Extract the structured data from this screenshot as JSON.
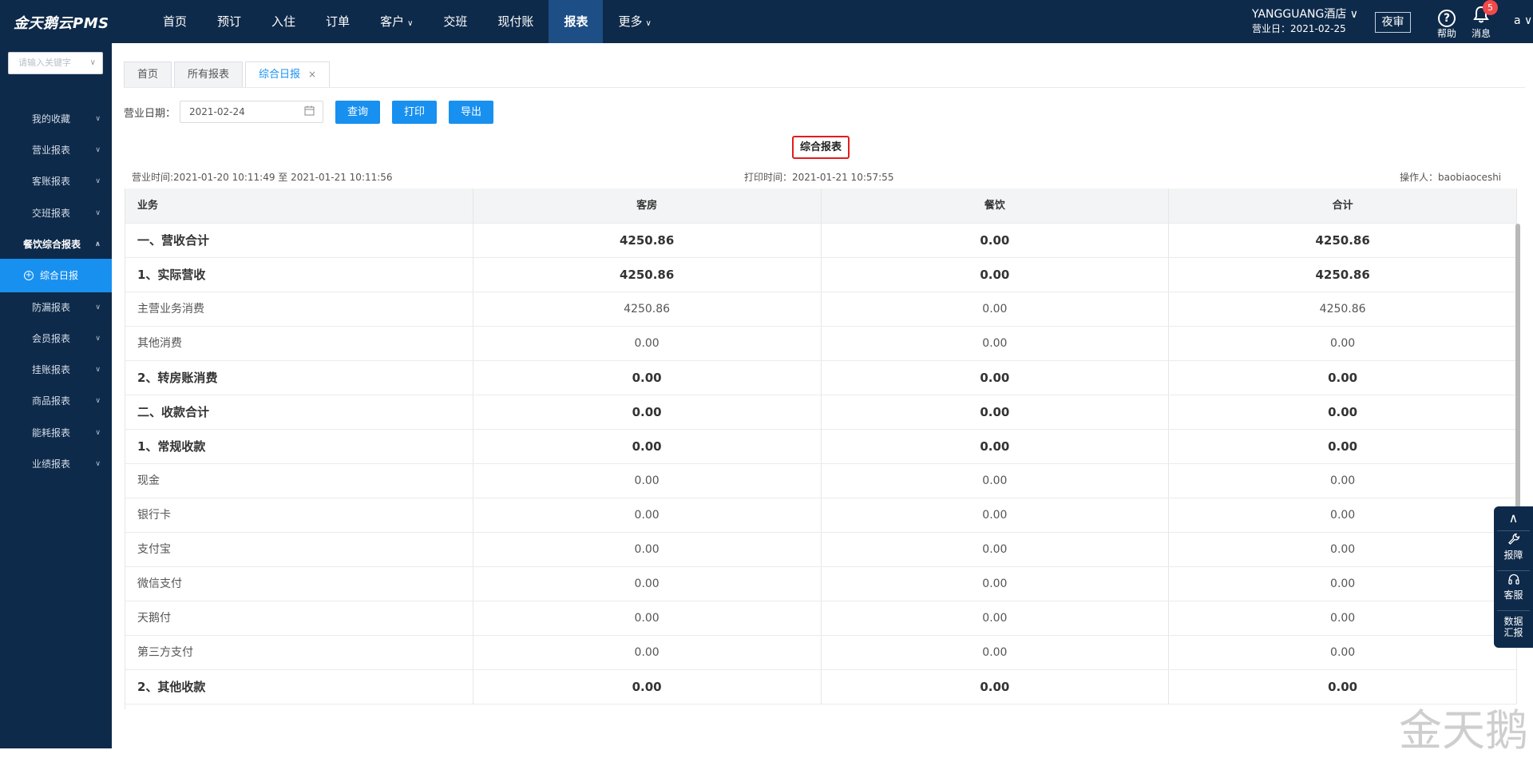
{
  "app": {
    "logo": "金天鹅云PMS"
  },
  "nav": {
    "items": [
      {
        "label": "首页",
        "caret": ""
      },
      {
        "label": "预订",
        "caret": ""
      },
      {
        "label": "入住",
        "caret": ""
      },
      {
        "label": "订单",
        "caret": ""
      },
      {
        "label": "客户",
        "caret": "∨"
      },
      {
        "label": "交班",
        "caret": ""
      },
      {
        "label": "现付账",
        "caret": ""
      },
      {
        "label": "报表",
        "caret": ""
      },
      {
        "label": "更多",
        "caret": "∨"
      }
    ],
    "active_index": 7
  },
  "header": {
    "hotel_name": "YANGGUANG酒店 ∨",
    "business_day": "营业日：2021-02-25",
    "audit_button": "夜审",
    "help_label": "帮助",
    "help_icon": "?",
    "message_label": "消息",
    "message_count": "5",
    "user": "a ∨"
  },
  "sidebar": {
    "search_placeholder": "请输入关键字",
    "items": [
      {
        "label": "我的收藏",
        "arrow": "∨"
      },
      {
        "label": "营业报表",
        "arrow": "∨"
      },
      {
        "label": "客账报表",
        "arrow": "∨"
      },
      {
        "label": "交班报表",
        "arrow": "∨"
      },
      {
        "label": "餐饮综合报表",
        "arrow": "∧"
      },
      {
        "label": "综合日报",
        "arrow": ""
      },
      {
        "label": "防漏报表",
        "arrow": "∨"
      },
      {
        "label": "会员报表",
        "arrow": "∨"
      },
      {
        "label": "挂账报表",
        "arrow": "∨"
      },
      {
        "label": "商品报表",
        "arrow": "∨"
      },
      {
        "label": "能耗报表",
        "arrow": "∨"
      },
      {
        "label": "业绩报表",
        "arrow": "∨"
      }
    ]
  },
  "tabs": [
    {
      "label": "首页"
    },
    {
      "label": "所有报表"
    },
    {
      "label": "综合日报",
      "close": "×"
    }
  ],
  "toolbar": {
    "date_label": "营业日期：",
    "date_value": "2021-02-24",
    "query_button": "查询",
    "print_button": "打印",
    "export_button": "导出"
  },
  "report": {
    "title": "综合报表",
    "business_time": "营业时间:2021-01-20 10:11:49 至 2021-01-21 10:11:56",
    "print_time": "打印时间：2021-01-21 10:57:55",
    "operator": "操作人：baobiaoceshi",
    "columns": [
      "业务",
      "客房",
      "餐饮",
      "合计"
    ],
    "rows": [
      {
        "name": "一、营收合计",
        "room": "4250.86",
        "food": "0.00",
        "total": "4250.86",
        "bold": true
      },
      {
        "name": "1、实际营收",
        "room": "4250.86",
        "food": "0.00",
        "total": "4250.86",
        "bold": true
      },
      {
        "name": "主营业务消费",
        "room": "4250.86",
        "food": "0.00",
        "total": "4250.86",
        "bold": false
      },
      {
        "name": "其他消费",
        "room": "0.00",
        "food": "0.00",
        "total": "0.00",
        "bold": false
      },
      {
        "name": "2、转房账消费",
        "room": "0.00",
        "food": "0.00",
        "total": "0.00",
        "bold": true
      },
      {
        "name": "二、收款合计",
        "room": "0.00",
        "food": "0.00",
        "total": "0.00",
        "bold": true
      },
      {
        "name": "1、常规收款",
        "room": "0.00",
        "food": "0.00",
        "total": "0.00",
        "bold": true
      },
      {
        "name": "现金",
        "room": "0.00",
        "food": "0.00",
        "total": "0.00",
        "bold": false
      },
      {
        "name": "银行卡",
        "room": "0.00",
        "food": "0.00",
        "total": "0.00",
        "bold": false
      },
      {
        "name": "支付宝",
        "room": "0.00",
        "food": "0.00",
        "total": "0.00",
        "bold": false
      },
      {
        "name": "微信支付",
        "room": "0.00",
        "food": "0.00",
        "total": "0.00",
        "bold": false
      },
      {
        "name": "天鹅付",
        "room": "0.00",
        "food": "0.00",
        "total": "0.00",
        "bold": false
      },
      {
        "name": "第三方支付",
        "room": "0.00",
        "food": "0.00",
        "total": "0.00",
        "bold": false
      },
      {
        "name": "2、其他收款",
        "room": "0.00",
        "food": "0.00",
        "total": "0.00",
        "bold": true
      }
    ]
  },
  "float_panel": {
    "top_icon": "∧",
    "repair_label": "报障",
    "service_label": "客服",
    "data_label_1": "数据",
    "data_label_2": "汇报"
  },
  "watermark": "金天鹅"
}
